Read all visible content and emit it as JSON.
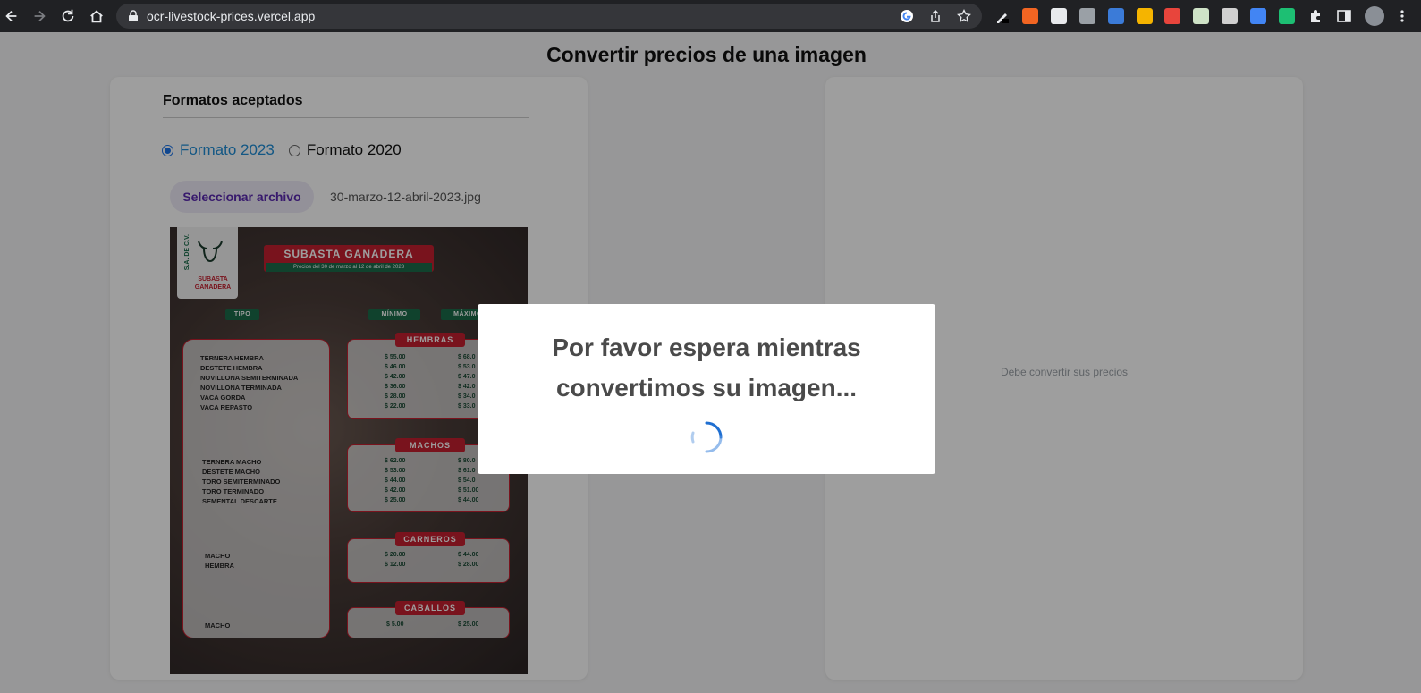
{
  "browser": {
    "url": "ocr-livestock-prices.vercel.app"
  },
  "page": {
    "title": "Convertir precios de una imagen"
  },
  "left_panel": {
    "section_title": "Formatos aceptados",
    "formats": [
      {
        "label": "Formato 2023",
        "selected": true
      },
      {
        "label": "Formato 2020",
        "selected": false
      }
    ],
    "file_button": "Seleccionar archivo",
    "file_name": "30-marzo-12-abril-2023.jpg"
  },
  "preview": {
    "logo_vertical": "S.A. DE C.V.",
    "logo_text_1": "SUBASTA",
    "logo_text_2": "GANADERA",
    "banner_title": "SUBASTA GANADERA",
    "banner_sub": "Precios del 30 de marzo  al 12 de abril de 2023",
    "col_tipo": "TIPO",
    "col_minimo": "MÍNIMO",
    "col_maximo": "MÁXIMO",
    "categories": [
      {
        "name": "HEMBRAS",
        "rows": [
          {
            "tipo": "TERNERA HEMBRA",
            "min": "$ 55.00",
            "max": "$ 68.0"
          },
          {
            "tipo": "DESTETE HEMBRA",
            "min": "$ 46.00",
            "max": "$ 53.0"
          },
          {
            "tipo": "NOVILLONA SEMITERMINADA",
            "min": "$ 42.00",
            "max": "$ 47.0"
          },
          {
            "tipo": "NOVILLONA TERMINADA",
            "min": "$ 36.00",
            "max": "$ 42.0"
          },
          {
            "tipo": "VACA GORDA",
            "min": "$ 28.00",
            "max": "$ 34.0"
          },
          {
            "tipo": "VACA REPASTO",
            "min": "$ 22.00",
            "max": "$ 33.0"
          }
        ]
      },
      {
        "name": "MACHOS",
        "rows": [
          {
            "tipo": "TERNERA MACHO",
            "min": "$ 62.00",
            "max": "$ 80.0"
          },
          {
            "tipo": "DESTETE MACHO",
            "min": "$ 53.00",
            "max": "$ 61.0"
          },
          {
            "tipo": "TORO SEMITERMINADO",
            "min": "$ 44.00",
            "max": "$ 54.0"
          },
          {
            "tipo": "TORO TERMINADO",
            "min": "$ 42.00",
            "max": "$ 51.00"
          },
          {
            "tipo": "SEMENTAL DESCARTE",
            "min": "$ 25.00",
            "max": "$ 44.00"
          }
        ]
      },
      {
        "name": "CARNEROS",
        "rows": [
          {
            "tipo": "MACHO",
            "min": "$ 20.00",
            "max": "$ 44.00"
          },
          {
            "tipo": "HEMBRA",
            "min": "$ 12.00",
            "max": "$ 28.00"
          }
        ]
      },
      {
        "name": "CABALLOS",
        "rows": [
          {
            "tipo": "MACHO",
            "min": "$ 5.00",
            "max": "$ 25.00"
          }
        ]
      }
    ]
  },
  "right_panel": {
    "empty_message": "Debe convertir sus precios"
  },
  "modal": {
    "line1": "Por favor espera mientras",
    "line2": "convertimos su imagen..."
  },
  "colors": {
    "accent_blue": "#1f8dd6",
    "file_button_text": "#5b2bb0",
    "flyer_red": "#c3202f",
    "flyer_green": "#1a6b4a"
  }
}
